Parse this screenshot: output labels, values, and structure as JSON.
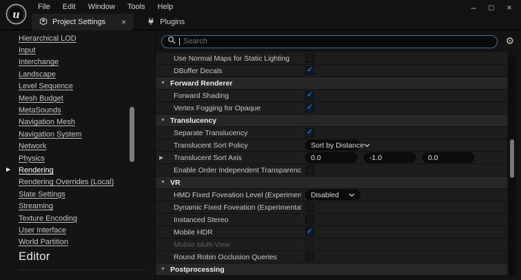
{
  "window": {
    "controls": {
      "minimize": "–",
      "maximize": "□",
      "close": "×"
    }
  },
  "menubar": {
    "items": [
      "File",
      "Edit",
      "Window",
      "Tools",
      "Help"
    ]
  },
  "tabs": [
    {
      "label": "Project Settings",
      "active": true,
      "close_glyph": "×"
    },
    {
      "label": "Plugins",
      "active": false
    }
  ],
  "sidebar": {
    "items": [
      "Hierarchical LOD",
      "Input",
      "Interchange",
      "Landscape",
      "Level Sequence",
      "Mesh Budget",
      "MetaSounds",
      "Navigation Mesh",
      "Navigation System",
      "Network",
      "Physics",
      "Rendering",
      "Rendering Overrides (Local)",
      "Slate Settings",
      "Streaming",
      "Texture Encoding",
      "User Interface",
      "World Partition"
    ],
    "selected": "Rendering",
    "footer_heading": "Editor"
  },
  "search": {
    "placeholder": "Search"
  },
  "icons": {
    "gear": "⚙",
    "selected_arrow": "▶",
    "section_collapse": "▼",
    "row_expand": "▶",
    "checkmark": "✓"
  },
  "settings": {
    "rows": [
      {
        "type": "setting",
        "label": "Use Normal Maps for Static Lighting",
        "control": "checkbox",
        "checked": false
      },
      {
        "type": "setting",
        "label": "DBuffer Decals",
        "control": "checkbox",
        "checked": true
      },
      {
        "type": "section",
        "label": "Forward Renderer"
      },
      {
        "type": "setting",
        "label": "Forward Shading",
        "control": "checkbox",
        "checked": true
      },
      {
        "type": "setting",
        "label": "Vertex Fogging for Opaque",
        "control": "checkbox",
        "checked": true
      },
      {
        "type": "section",
        "label": "Translucency"
      },
      {
        "type": "setting",
        "label": "Separate Translucency",
        "control": "checkbox",
        "checked": true
      },
      {
        "type": "setting",
        "label": "Translucent Sort Policy",
        "control": "dropdown",
        "value": "Sort by Distance"
      },
      {
        "type": "setting",
        "label": "Translucent Sort Axis",
        "control": "vector",
        "values": [
          "0.0",
          "-1.0",
          "0.0"
        ],
        "expandable": true
      },
      {
        "type": "setting",
        "label": "Enable Order Independent Transparency (Experimental)",
        "control": "checkbox",
        "checked": false
      },
      {
        "type": "section",
        "label": "VR"
      },
      {
        "type": "setting",
        "label": "HMD Fixed Foveation Level (Experimental)",
        "control": "dropdown",
        "value": "Disabled"
      },
      {
        "type": "setting",
        "label": "Dynamic Fixed Foveation (Experimental)",
        "control": "checkbox",
        "checked": false
      },
      {
        "type": "setting",
        "label": "Instanced Stereo",
        "control": "checkbox",
        "checked": false
      },
      {
        "type": "setting",
        "label": "Mobile HDR",
        "control": "checkbox",
        "checked": true
      },
      {
        "type": "setting",
        "label": "Mobile Multi-View",
        "control": "checkbox",
        "checked": false,
        "disabled": true
      },
      {
        "type": "setting",
        "label": "Round Robin Occlusion Queries",
        "control": "checkbox",
        "checked": false
      },
      {
        "type": "section",
        "label": "Postprocessing"
      }
    ]
  },
  "colors": {
    "accent_check": "#4a8fe6",
    "search_border": "#40709d",
    "section_bg": "#272727",
    "row_bg": "#1d1d1d",
    "sidebar_bg": "#141414"
  }
}
